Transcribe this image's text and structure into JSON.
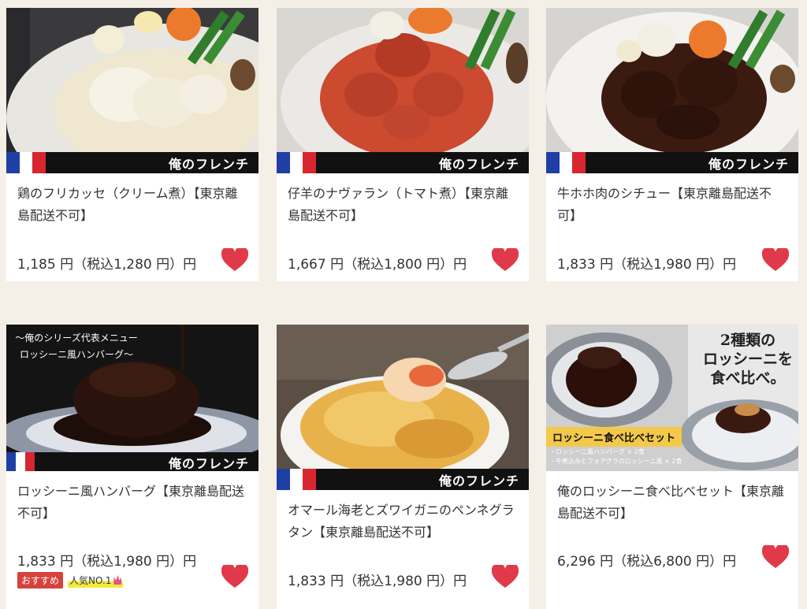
{
  "brand_logo": "俺のフレンチ",
  "products": [
    {
      "title": "鶏のフリカッセ（クリーム煮）【東京離島配送不可】",
      "price": "1,185 円（税込1,280 円）円",
      "image_icon": "chicken-fricassee-photo",
      "favorite": true
    },
    {
      "title": "仔羊のナヴァラン（トマト煮）【東京離島配送不可】",
      "price": "1,667 円（税込1,800 円）円",
      "image_icon": "lamb-navarin-photo",
      "favorite": true
    },
    {
      "title": "牛ホホ肉のシチュー【東京離島配送不可】",
      "price": "1,833 円（税込1,980 円）円",
      "image_icon": "beef-cheek-stew-photo",
      "favorite": true
    },
    {
      "title": "ロッシーニ風ハンバーグ【東京離島配送不可】",
      "price": "1,833 円（税込1,980 円）円",
      "image_icon": "rossini-hamburg-photo",
      "promo_lines": [
        "〜俺のシリーズ代表メニュー",
        "ロッシーニ風ハンバーグ〜"
      ],
      "badges": {
        "recommended": "おすすめ",
        "popular": "人気NO.1"
      },
      "favorite": true
    },
    {
      "title": "オマール海老とズワイガニのペンネグラタン【東京離島配送不可】",
      "price": "1,833 円（税込1,980 円）円",
      "image_icon": "lobster-crab-gratin-photo",
      "favorite": true
    },
    {
      "title": "俺のロッシーニ食べ比べセット【東京離島配送不可】",
      "price": "6,296 円（税込6,800 円）円",
      "image_icon": "rossini-set-photo",
      "set_heading": [
        "2種類の",
        "ロッシーニを",
        "食べ比べ。"
      ],
      "set_label": "ロッシーニ食べ比べセット",
      "set_sub": [
        "・ロッシーニ風ハンバーグ × 2食",
        "・牛煮込みとフォアグラのロッシーニ風 × 2食"
      ],
      "favorite": true
    }
  ],
  "colors": {
    "background": "#f4efe7",
    "heart": "#e03a4a",
    "flag_blue": "#1f3fa5",
    "flag_red": "#d8252f"
  }
}
